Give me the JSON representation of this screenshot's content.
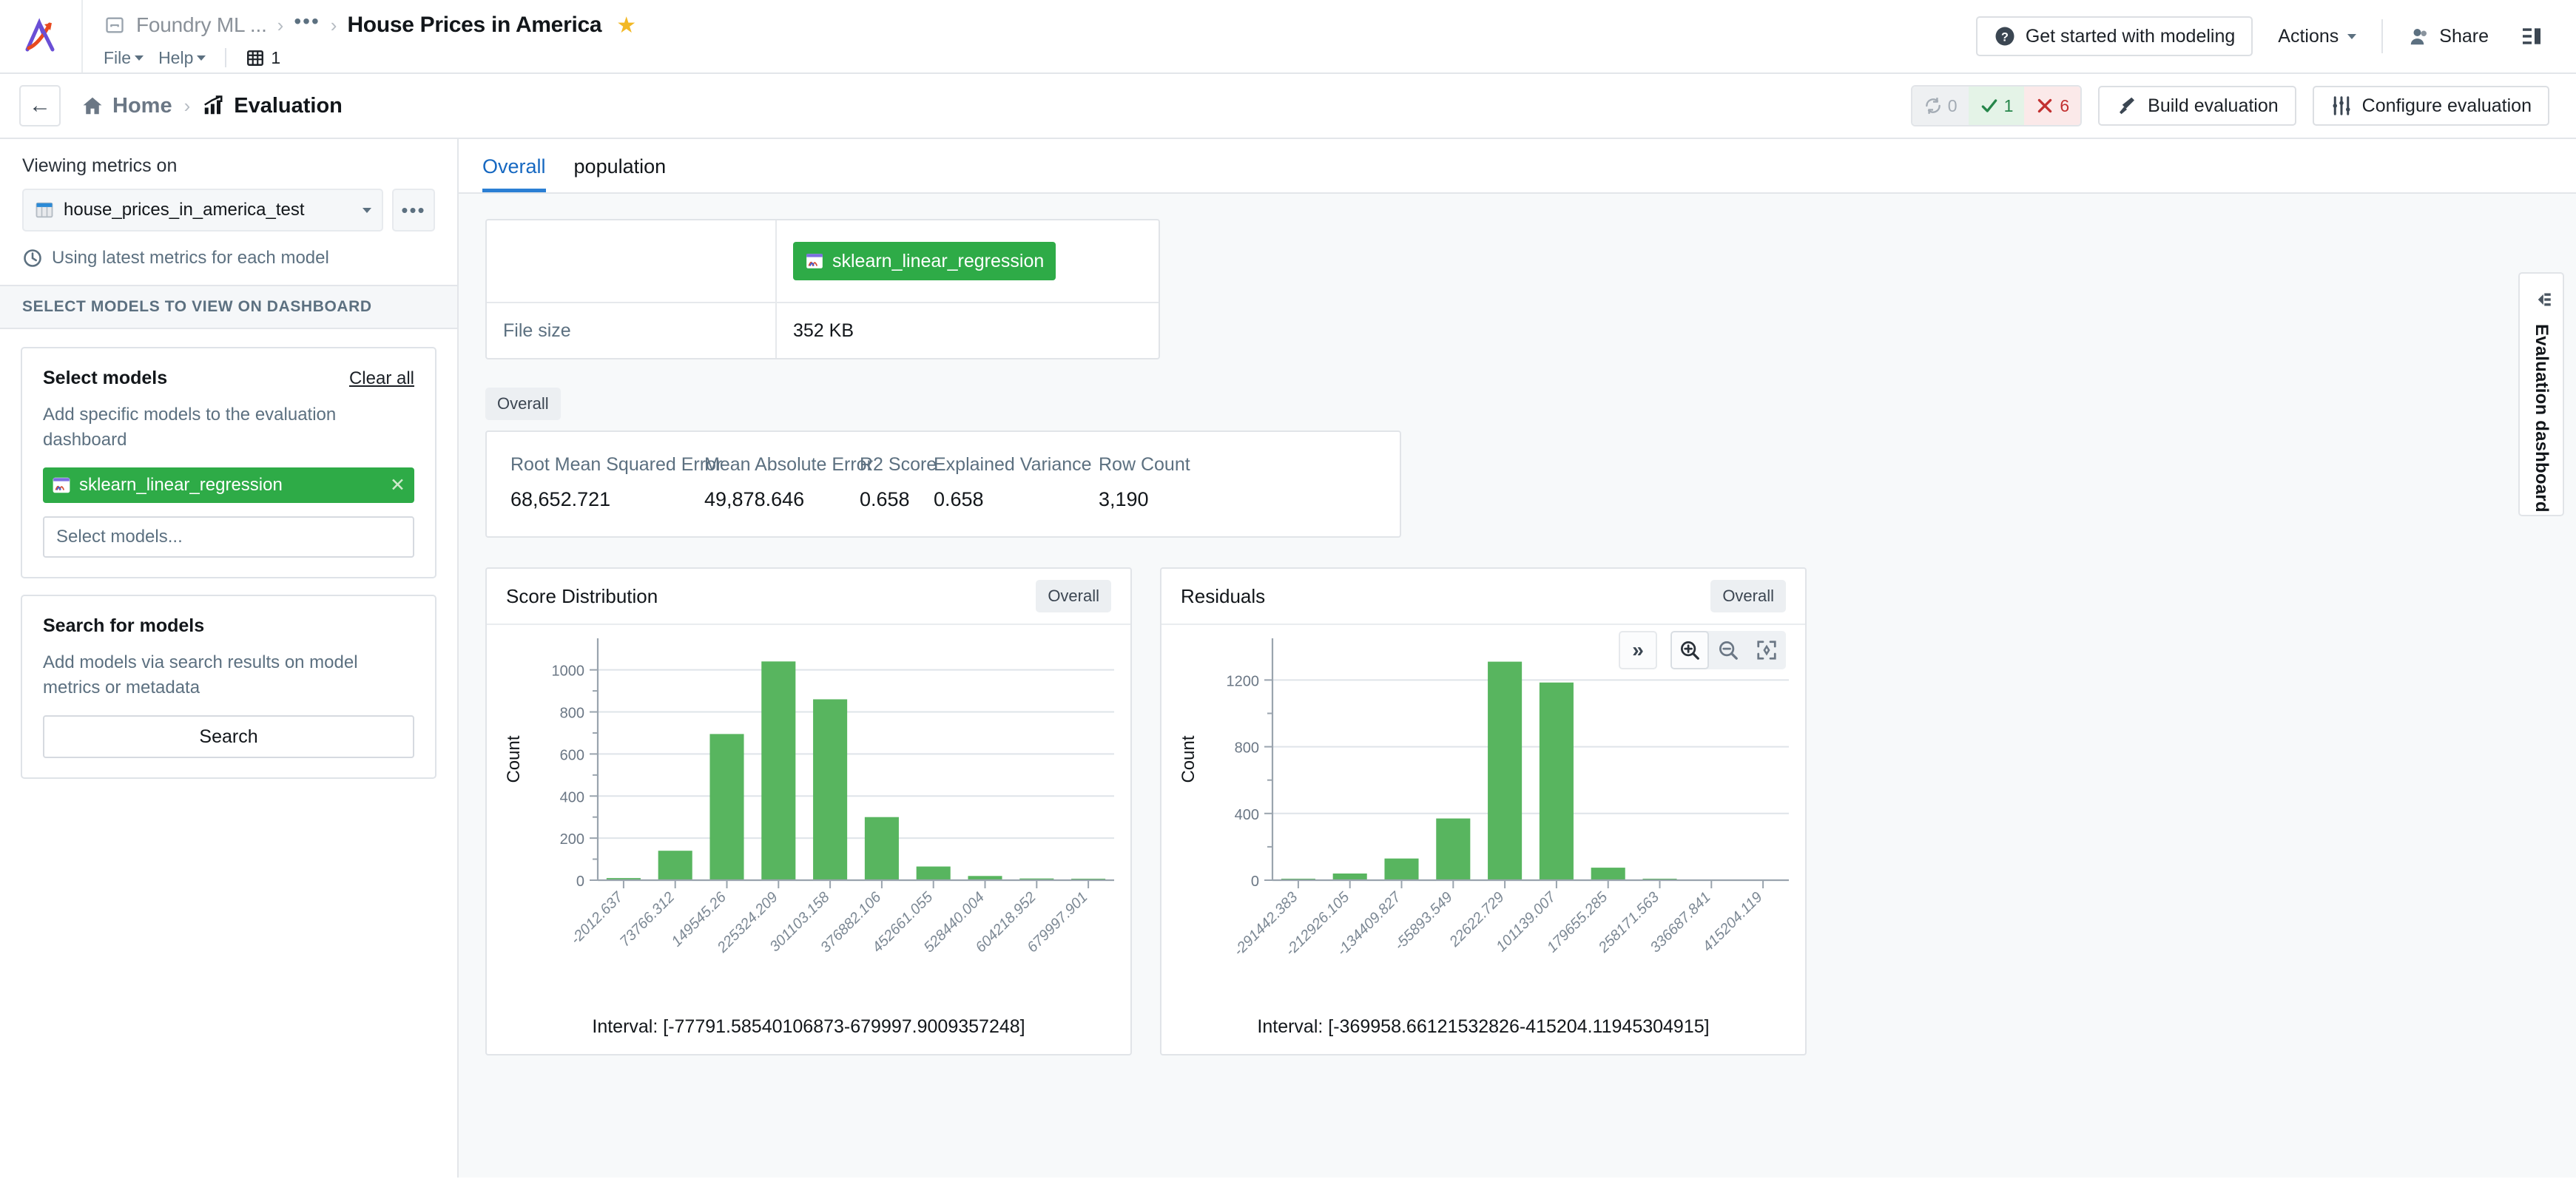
{
  "topbar": {
    "breadcrumb_root": "Foundry ML ...",
    "breadcrumb_ellipsis": "•••",
    "breadcrumb_sep": "›",
    "title": "House Prices in America",
    "star_icon": "star-icon",
    "menu": [
      {
        "label": "File"
      },
      {
        "label": "Help"
      }
    ],
    "pages_count": "1",
    "get_started_label": "Get started with modeling",
    "actions_label": "Actions",
    "share_label": "Share"
  },
  "subbar": {
    "back_label": "←",
    "home_label": "Home",
    "sep": "›",
    "current_label": "Evaluation",
    "status": {
      "stale_count": "0",
      "success_count": "1",
      "failed_count": "6"
    },
    "build_label": "Build evaluation",
    "configure_label": "Configure evaluation"
  },
  "sidebar": {
    "viewing_label": "Viewing metrics on",
    "dataset_value": "house_prices_in_america_test",
    "more_icon": "•••",
    "latest_metrics_note": "Using latest metrics for each model",
    "section_header": "SELECT MODELS TO VIEW ON DASHBOARD",
    "select_models_card": {
      "title": "Select models",
      "clear_all": "Clear all",
      "description": "Add specific models to the evaluation dashboard",
      "selected_model": "sklearn_linear_regression",
      "input_placeholder": "Select models..."
    },
    "search_card": {
      "title": "Search for models",
      "description": "Add models via search results on model metrics or metadata",
      "button_label": "Search"
    }
  },
  "main": {
    "tabs": [
      {
        "label": "Overall",
        "active": true
      },
      {
        "label": "population",
        "active": false
      }
    ],
    "model_table": {
      "model_chip": "sklearn_linear_regression",
      "rows": [
        {
          "key": "File size",
          "value": "352 KB"
        }
      ]
    },
    "metrics_pill": "Overall",
    "metrics": [
      {
        "key": "Root Mean Squared Error",
        "value": "68,652.721"
      },
      {
        "key": "Mean Absolute Error",
        "value": "49,878.646"
      },
      {
        "key": "R2 Score",
        "value": "0.658"
      },
      {
        "key": "Explained Variance",
        "value": "0.658"
      },
      {
        "key": "Row Count",
        "value": "3,190"
      }
    ],
    "chart_tools": {
      "expand_label": "»",
      "zoom_in": "zoom-in-icon",
      "zoom_out": "zoom-out-icon",
      "fit": "fit-icon"
    }
  },
  "right_rail": {
    "label": "Evaluation dashboard",
    "collapse_icon": "collapse-panel-icon"
  },
  "colors": {
    "accent_blue": "#2b7fd4",
    "model_green": "#2eab47",
    "bar_green": "#58b55f",
    "success": "#26864a",
    "danger": "#c23030",
    "muted": "#5c7080"
  },
  "chart_data": [
    {
      "type": "bar",
      "title": "Score Distribution",
      "badge": "Overall",
      "xlabel": "",
      "ylabel": "Count",
      "categories": [
        "-2012.637",
        "73766.312",
        "149545.26",
        "225324.209",
        "301103.158",
        "376882.106",
        "452661.055",
        "528440.004",
        "604218.952",
        "679997.901"
      ],
      "values": [
        10,
        140,
        695,
        1040,
        860,
        300,
        65,
        20,
        8,
        6
      ],
      "yticks": [
        0,
        200,
        400,
        600,
        800,
        1000
      ],
      "ylim": [
        0,
        1150
      ],
      "grid": true,
      "caption": "Interval: [-77791.58540106873-679997.9009357248]"
    },
    {
      "type": "bar",
      "title": "Residuals",
      "badge": "Overall",
      "xlabel": "",
      "ylabel": "Count",
      "categories": [
        "-291442.383",
        "-212926.105",
        "-134409.827",
        "-55893.549",
        "22622.729",
        "101139.007",
        "179655.285",
        "258171.563",
        "336687.841",
        "415204.119"
      ],
      "values": [
        5,
        40,
        130,
        370,
        1310,
        1185,
        75,
        5,
        0,
        0
      ],
      "yticks": [
        0,
        400,
        800,
        1200
      ],
      "ylim": [
        0,
        1450
      ],
      "grid": true,
      "caption": "Interval: [-369958.66121532826-415204.11945304915]"
    }
  ]
}
